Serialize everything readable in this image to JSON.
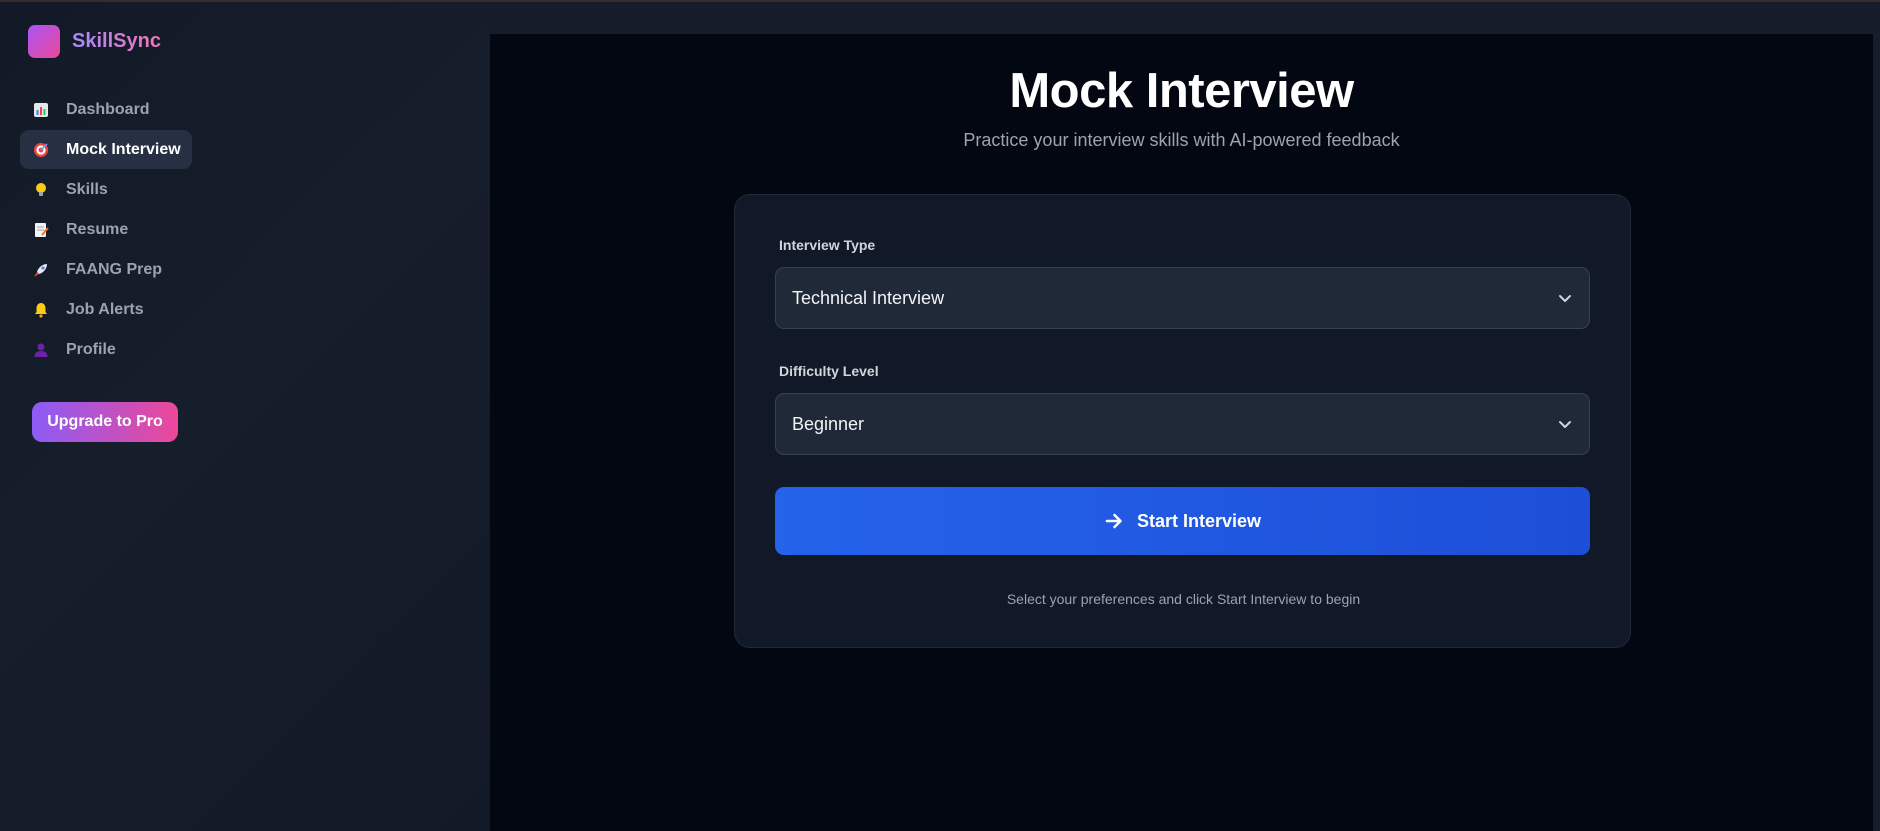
{
  "app": {
    "name": "SkillSync"
  },
  "sidebar": {
    "items": [
      {
        "label": "Dashboard",
        "icon": "bar-chart-icon",
        "active": false
      },
      {
        "label": "Mock Interview",
        "icon": "target-icon",
        "active": true
      },
      {
        "label": "Skills",
        "icon": "lightbulb-icon",
        "active": false
      },
      {
        "label": "Resume",
        "icon": "memo-icon",
        "active": false
      },
      {
        "label": "FAANG Prep",
        "icon": "rocket-icon",
        "active": false
      },
      {
        "label": "Job Alerts",
        "icon": "bell-icon",
        "active": false
      },
      {
        "label": "Profile",
        "icon": "user-icon",
        "active": false
      }
    ],
    "upgrade_label": "Upgrade to Pro"
  },
  "main": {
    "title": "Mock Interview",
    "subtitle": "Practice your interview skills with AI-powered feedback",
    "form": {
      "interview_type": {
        "label": "Interview Type",
        "selected": "Technical Interview"
      },
      "difficulty": {
        "label": "Difficulty Level",
        "selected": "Beginner"
      },
      "start_label": "Start Interview",
      "hint": "Select your preferences and click Start Interview to begin"
    }
  },
  "colors": {
    "accent_blue": "#2563eb",
    "brand_purple": "#8b5cf6",
    "brand_pink": "#ec4899",
    "background": "#030712"
  }
}
